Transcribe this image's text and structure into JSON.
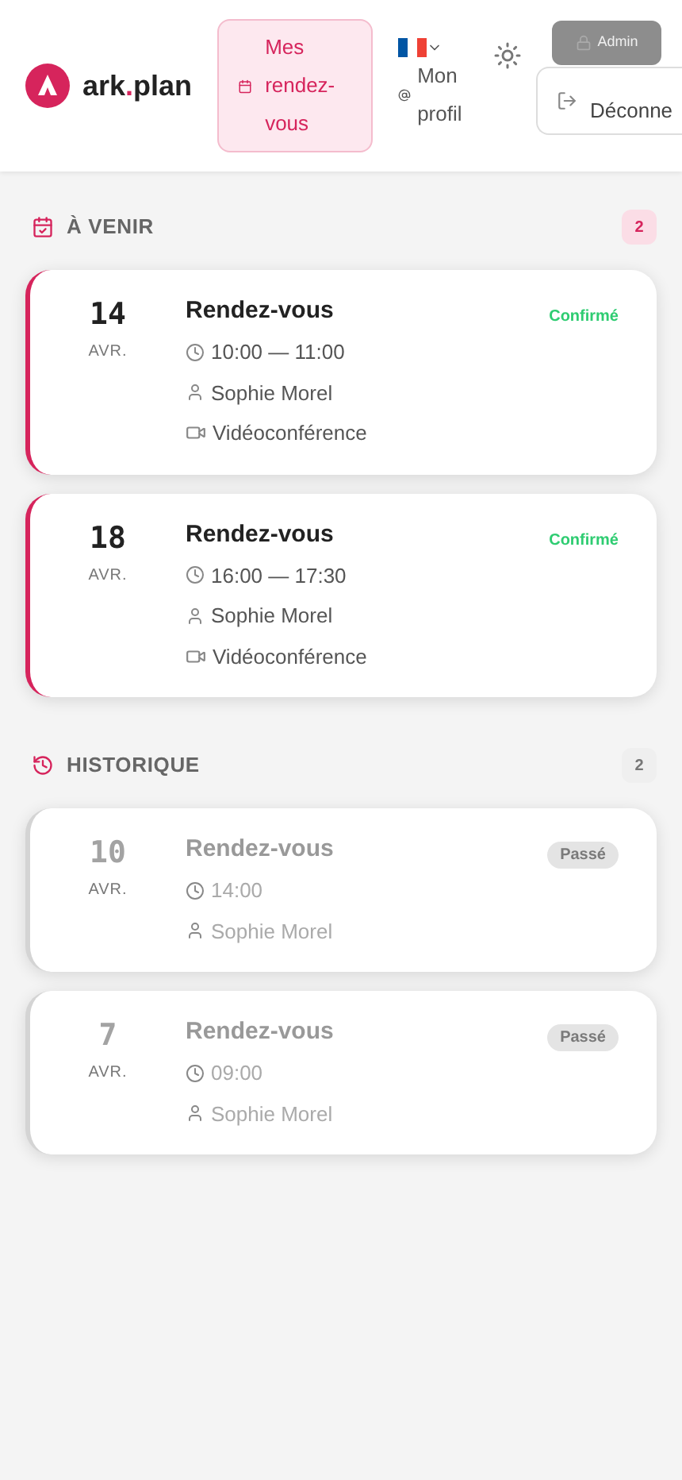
{
  "header": {
    "logo": {
      "prefix": "ark",
      "dot": ".",
      "suffix": "plan"
    },
    "nav": [
      {
        "label": "Mes rendez-vous",
        "selected": true
      },
      {
        "label": "Mon profil",
        "selected": false
      }
    ],
    "admin": "Admin",
    "logout": "Déconne"
  },
  "sections": [
    {
      "kind": "upcoming",
      "title": "À VENIR",
      "count": "2",
      "appointments": [
        {
          "day": "14",
          "month": "AVR.",
          "title": "Rendez-vous",
          "time": "10:00 — 11:00",
          "person": "Sophie Morel",
          "location": "Vidéoconférence",
          "status": {
            "kind": "confirmed",
            "label": "Confirmé"
          }
        },
        {
          "day": "18",
          "month": "AVR.",
          "title": "Rendez-vous",
          "time": "16:00 — 17:30",
          "person": "Sophie Morel",
          "location": "Vidéoconférence",
          "status": {
            "kind": "confirmed",
            "label": "Confirmé"
          }
        }
      ]
    },
    {
      "kind": "history",
      "title": "HISTORIQUE",
      "count": "2",
      "appointments": [
        {
          "day": "10",
          "month": "AVR.",
          "title": "Rendez-vous",
          "time": "14:00",
          "person": "Sophie Morel",
          "status": {
            "kind": "past",
            "label": "Passé"
          }
        },
        {
          "day": "7",
          "month": "AVR.",
          "title": "Rendez-vous",
          "time": "09:00",
          "person": "Sophie Morel",
          "status": {
            "kind": "past",
            "label": "Passé"
          }
        }
      ]
    }
  ]
}
